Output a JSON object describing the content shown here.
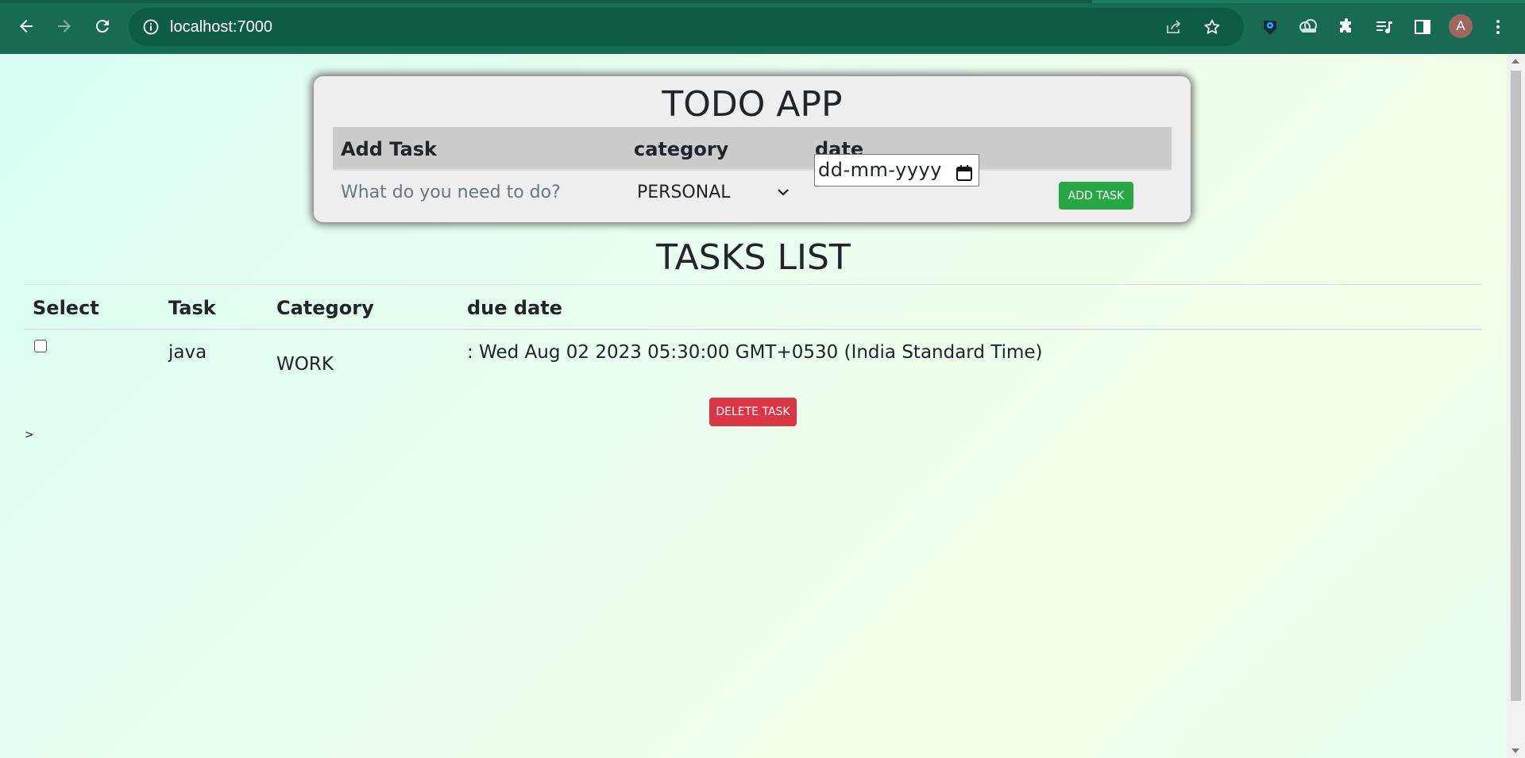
{
  "browser": {
    "url": "localhost:7000",
    "profile_initial": "A",
    "icons": [
      "back-arrow-icon",
      "forward-arrow-icon",
      "reload-icon",
      "info-icon",
      "share-icon",
      "star-icon",
      "extension-eye-icon",
      "extension-cloud-icon",
      "puzzle-icon",
      "media-queue-icon",
      "sidebar-icon",
      "more-vert-icon"
    ],
    "colors": {
      "toolbar": "#176b52",
      "omnibox": "#0f5c45"
    }
  },
  "todo_card": {
    "title": "TODO APP",
    "headers": {
      "add_task": "Add Task",
      "category": "category",
      "date": "date"
    },
    "task_placeholder": "What do you need to do?",
    "category_value": "PERSONAL",
    "date_placeholder": "dd-mm-yyyy",
    "add_button": "ADD TASK"
  },
  "tasks": {
    "title": "TASKS LIST",
    "columns": [
      "Select",
      "Task",
      "Category",
      "due date"
    ],
    "rows": [
      {
        "task": "java",
        "category": "WORK",
        "due": ": Wed Aug 02 2023 05:30:00 GMT+0530 (India Standard Time)",
        "checked": false
      }
    ],
    "delete_button": "DELETE TASK",
    "stray_text": ">"
  },
  "colors": {
    "add_button": "#28a745",
    "delete_button": "#dc3545"
  }
}
